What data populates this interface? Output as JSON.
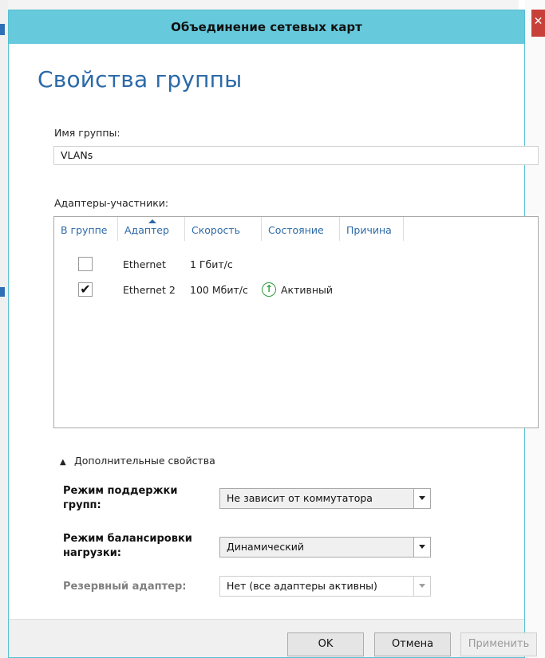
{
  "dialog": {
    "title": "Объединение сетевых карт",
    "heading": "Свойства группы"
  },
  "team_name": {
    "label": "Имя группы:",
    "value": "VLANs"
  },
  "members": {
    "label": "Адаптеры-участники:",
    "columns": [
      "В группе",
      "Адаптер",
      "Скорость",
      "Состояние",
      "Причина"
    ],
    "rows": [
      {
        "in_team": false,
        "adapter": "Ethernet",
        "speed": "1 Гбит/с",
        "state": "",
        "reason": ""
      },
      {
        "in_team": true,
        "adapter": "Ethernet 2",
        "speed": "100 Мбит/с",
        "state": "Активный",
        "reason": ""
      }
    ]
  },
  "advanced": {
    "toggle_label": "Дополнительные свойства",
    "teaming_mode_label": "Режим поддержки групп:",
    "teaming_mode_value": "Не зависит от коммутатора",
    "load_balancing_label": "Режим балансировки нагрузки:",
    "load_balancing_value": "Динамический",
    "standby_label": "Резервный адаптер:",
    "standby_value": "Нет (все адаптеры активны)"
  },
  "buttons": {
    "ok": "OK",
    "cancel": "Отмена",
    "apply": "Применить"
  },
  "colors": {
    "titlebar": "#67c9dc",
    "heading": "#2c6aa8",
    "active_status": "#2f9a3a"
  },
  "icons": {
    "close": "close-icon",
    "sort": "sort-ascending-icon",
    "status_active": "arrow-up-circle-icon",
    "expand": "chevron-up-icon",
    "dropdown": "chevron-down-icon"
  }
}
